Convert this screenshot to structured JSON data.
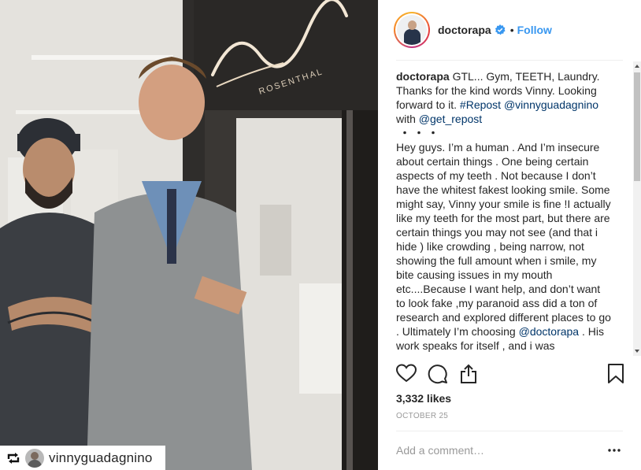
{
  "post": {
    "username": "doctorapa",
    "separator": "•",
    "follow_label": "Follow",
    "verified_icon": "verified-badge-icon",
    "caption": {
      "author": "doctorapa",
      "line1": " GTL... Gym, TEETH, Laundry. Thanks for the kind words Vinny. Looking forward to it. ",
      "hashtag": "#Repost",
      "space": " ",
      "mention1": "@vinnyguadagnino",
      "with": "with ",
      "mention2": "@get_repost",
      "dots": "・・・",
      "body1": "Hey guys. I’m a human . And I’m insecure about certain things . One being certain aspects of my teeth . Not because I don’t have the whitest fakest looking smile. Some might say, Vinny your smile is fine !I actually like my teeth for the most part, but there are certain things you may not see (and that i hide ) like crowding , being narrow, not showing the full amount when i smile, my bite causing issues in my mouth etc....Because I want help, and don’t want to look fake ,my paranoid ass did a ton of research and explored different places to go . Ultimately I’m choosing ",
      "mention3": "@doctorapa",
      "body2": " . His work speaks for itself , and i was recommended to him by other patients"
    },
    "likes": "3,332 likes",
    "date": "OCTOBER 25",
    "comment_placeholder": "Add a comment…"
  },
  "repost_badge": {
    "username": "vinnyguadagnino",
    "icon": "repost-icon"
  },
  "photo": {
    "sign_text": "ROSENTHAL",
    "sign_script": "apa"
  },
  "colors": {
    "link": "#003569",
    "follow": "#3897f0",
    "muted": "#999999",
    "text": "#262626"
  }
}
